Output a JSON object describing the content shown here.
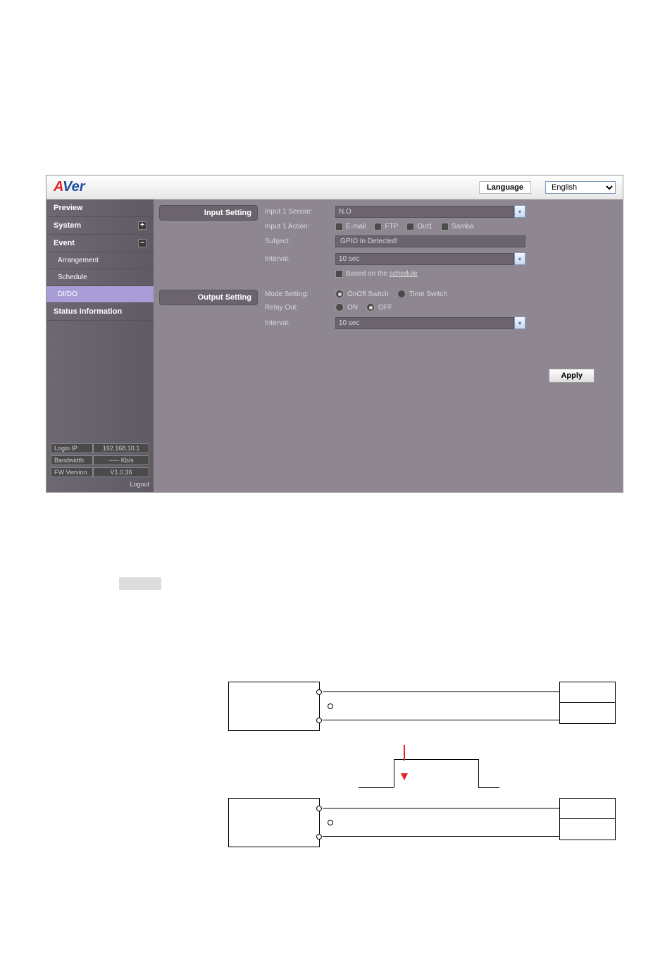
{
  "header": {
    "logo_parts": {
      "a": "A",
      "v": "V",
      "e": "e",
      "r": "r"
    },
    "language_label": "Language",
    "language_value": "English"
  },
  "sidebar": {
    "items": [
      {
        "label": "Preview",
        "type": "top"
      },
      {
        "label": "System",
        "type": "top",
        "icon": "plus"
      },
      {
        "label": "Event",
        "type": "top",
        "icon": "minus"
      },
      {
        "label": "Arrangement",
        "type": "sub"
      },
      {
        "label": "Schedule",
        "type": "sub"
      },
      {
        "label": "DI/DO",
        "type": "sub",
        "active": true
      },
      {
        "label": "Status Information",
        "type": "top"
      }
    ],
    "info": [
      {
        "label": "Login IP",
        "value": "192.168.10.1"
      },
      {
        "label": "Bandwidth",
        "value": "----- Kb/s"
      },
      {
        "label": "FW Version",
        "value": "V1.0.36"
      }
    ],
    "logout": "Logout"
  },
  "input_setting": {
    "title": "Input Setting",
    "rows": {
      "sensor_label": "Input 1 Sensor:",
      "sensor_value": "N.O",
      "action_label": "Input 1 Action:",
      "actions": {
        "email": "E-mail",
        "ftp": "FTP",
        "out1": "Out1",
        "samba": "Samba"
      },
      "subject_label": "Subject:",
      "subject_value": "GPIO In Detected!",
      "interval_label": "Interval:",
      "interval_value": "10 sec",
      "schedule_cb": "Based on the",
      "schedule_link": "schedule"
    }
  },
  "output_setting": {
    "title": "Output Setting",
    "rows": {
      "mode_label": "Mode Setting:",
      "mode_onoff": "OnOff Switch",
      "mode_time": "Time Switch",
      "relay_label": "Relay Out:",
      "relay_on": "ON",
      "relay_off": "OFF",
      "interval_label": "Interval:",
      "interval_value": "10 sec"
    }
  },
  "apply_button": "Apply"
}
